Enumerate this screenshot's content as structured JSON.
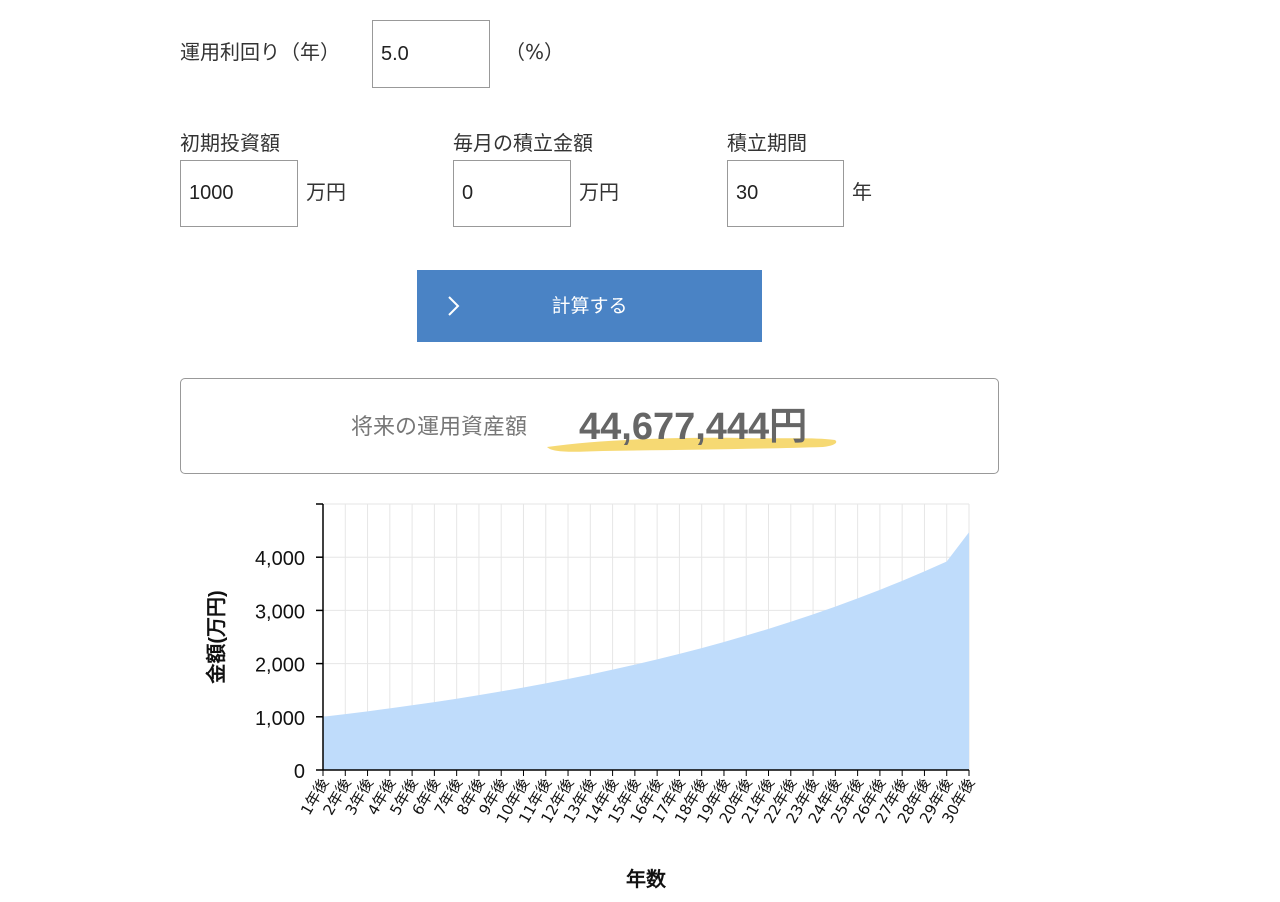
{
  "form": {
    "rate": {
      "label": "運用利回り（年）",
      "value": "5.0",
      "unit": "（%）"
    },
    "initial": {
      "label": "初期投資額",
      "value": "1000",
      "unit": "万円"
    },
    "monthly": {
      "label": "毎月の積立金額",
      "value": "0",
      "unit": "万円"
    },
    "period": {
      "label": "積立期間",
      "value": "30",
      "unit": "年"
    },
    "calculate_label": "計算する"
  },
  "result": {
    "label": "将来の運用資産額",
    "value": "44,677,444円"
  },
  "colors": {
    "button": "#4a83c5",
    "area_fill": "#bfdcfb",
    "highlight": "#f5d25a"
  },
  "chart_data": {
    "type": "area",
    "xlabel": "年数",
    "ylabel": "金額(万円)",
    "ylim": [
      0,
      5000
    ],
    "yticks": [
      "0",
      "1,000",
      "2,000",
      "3,000",
      "4,000"
    ],
    "yticks_values": [
      0,
      1000,
      2000,
      3000,
      4000
    ],
    "categories": [
      "1年後",
      "2年後",
      "3年後",
      "4年後",
      "5年後",
      "6年後",
      "7年後",
      "8年後",
      "9年後",
      "10年後",
      "11年後",
      "12年後",
      "13年後",
      "14年後",
      "15年後",
      "16年後",
      "17年後",
      "18年後",
      "19年後",
      "20年後",
      "21年後",
      "22年後",
      "23年後",
      "24年後",
      "25年後",
      "26年後",
      "27年後",
      "28年後",
      "29年後",
      "30年後"
    ],
    "series": [
      {
        "values": [
          1000,
          1050,
          1103,
          1158,
          1216,
          1276,
          1340,
          1407,
          1477,
          1551,
          1629,
          1710,
          1796,
          1886,
          1980,
          2079,
          2183,
          2292,
          2407,
          2527,
          2653,
          2786,
          2925,
          3072,
          3225,
          3386,
          3556,
          3733,
          3920,
          4468
        ]
      }
    ],
    "grid": true,
    "legend": "none"
  }
}
